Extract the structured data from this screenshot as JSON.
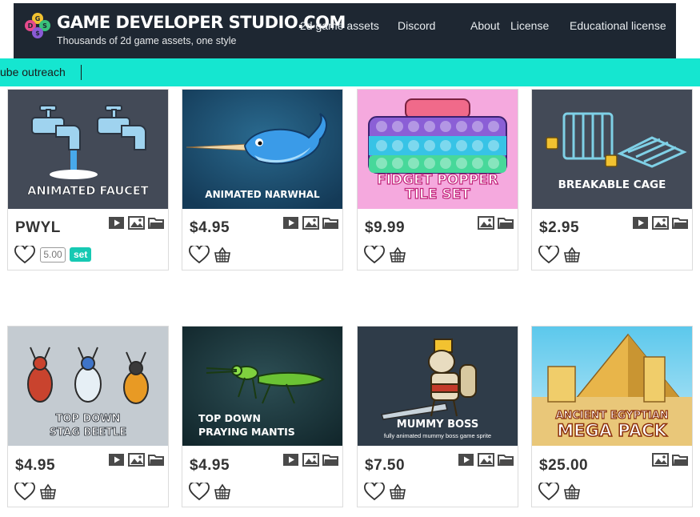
{
  "header": {
    "title": "GAME DEVELOPER STUDIO.COM",
    "tagline": "Thousands of 2d game assets, one style",
    "nav": [
      "2d game assets",
      "Discord",
      "About",
      "License",
      "Educational license"
    ]
  },
  "ticker": {
    "text": "ube outreach"
  },
  "colors": {
    "header_bg": "#1e2732",
    "ticker_bg": "#15e6d0",
    "accent": "#16c9b3"
  },
  "rating": {
    "value": "5.00",
    "set_label": "set"
  },
  "products": [
    {
      "title": "ANIMATED FAUCET",
      "price": "PWYL",
      "icons": [
        "video-icon",
        "image-icon",
        "folder-icon"
      ]
    },
    {
      "title": "ANIMATED NARWHAL",
      "price": "$4.95",
      "icons": [
        "video-icon",
        "image-icon",
        "folder-icon"
      ]
    },
    {
      "title": "FIDGET POPPER",
      "title2": "TILE SET",
      "price": "$9.99",
      "icons": [
        "image-icon",
        "folder-icon"
      ]
    },
    {
      "title": "BREAKABLE CAGE",
      "price": "$2.95",
      "icons": [
        "video-icon",
        "image-icon",
        "folder-icon"
      ]
    },
    {
      "title": "TOP DOWN",
      "title2": "STAG BEETLE",
      "price": "$4.95",
      "icons": [
        "video-icon",
        "image-icon",
        "folder-icon"
      ]
    },
    {
      "title": "TOP DOWN",
      "title2": "PRAYING MANTIS",
      "price": "$4.95",
      "icons": [
        "video-icon",
        "image-icon",
        "folder-icon"
      ]
    },
    {
      "title": "MUMMY BOSS",
      "subtitle": "fully animated mummy boss game sprite",
      "price": "$7.50",
      "icons": [
        "video-icon",
        "image-icon",
        "folder-icon"
      ]
    },
    {
      "title": "ANCIENT EGYPTIAN",
      "title2": "MEGA PACK",
      "price": "$25.00",
      "icons": [
        "image-icon",
        "folder-icon"
      ]
    }
  ]
}
